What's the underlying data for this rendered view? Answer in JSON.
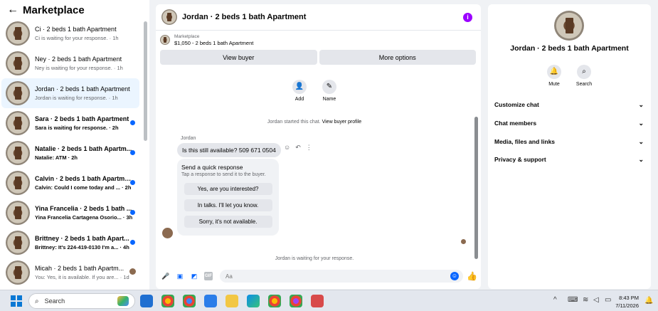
{
  "sidebar": {
    "title": "Marketplace",
    "chats": [
      {
        "name": "Ci · 2 beds 1 bath Apartment",
        "preview": "Ci is waiting for your response. · 1h",
        "unread": false,
        "active": false
      },
      {
        "name": "Ney · 2 beds 1 bath Apartment",
        "preview": "Ney is waiting for your response. · 1h",
        "unread": false,
        "active": false
      },
      {
        "name": "Jordan · 2 beds 1 bath Apartment",
        "preview": "Jordan is waiting for response. · 1h",
        "unread": false,
        "active": true
      },
      {
        "name": "Sara · 2 beds 1 bath Apartment",
        "preview": "Sara is waiting for response. · 2h",
        "unread": true,
        "active": false
      },
      {
        "name": "Natalie · 2 beds 1 bath Apartm...",
        "preview": "Natalie: ATM · 2h",
        "unread": true,
        "active": false
      },
      {
        "name": "Calvin · 2 beds 1 bath Apartment",
        "preview": "Calvin: Could I come today and ... · 2h",
        "unread": true,
        "active": false
      },
      {
        "name": "Yina Francelia · 2 beds 1 bath ...",
        "preview": "Yina Francelia Cartagena Osorio... · 3h",
        "unread": true,
        "active": false
      },
      {
        "name": "Brittney · 2 beds 1 bath Apart...",
        "preview": "Brittney: It's 224-419-0130 I'm a... · 4h",
        "unread": true,
        "active": false
      },
      {
        "name": "Micah · 2 beds 1 bath Apartm...",
        "preview": "You: Yes, it is available. If you are... · 1d",
        "unread": false,
        "active": false
      }
    ]
  },
  "conversation": {
    "title": "Jordan · 2 beds 1 bath Apartment",
    "listing_label": "Marketplace",
    "listing_price": "$1,050 - 2 beds 1 bath Apartment",
    "view_buyer": "View buyer",
    "more_options": "More options",
    "add_label": "Add",
    "name_label": "Name",
    "started_text": "Jordan started this chat.",
    "view_profile": "View buyer profile",
    "sender": "Jordan",
    "message": "Is this still available? 509 671 0504",
    "quick_title": "Send a quick response",
    "quick_sub": "Tap a response to send it to the buyer.",
    "quick_responses": [
      "Yes, are you interested?",
      "In talks. I'll let you know.",
      "Sorry, it's not available."
    ],
    "waiting_text": "Jordan is waiting for your response.",
    "input_placeholder": "Aa"
  },
  "details": {
    "title": "Jordan · 2 beds 1 bath Apartment",
    "mute": "Mute",
    "search": "Search",
    "menu": [
      "Customize chat",
      "Chat members",
      "Media, files and links",
      "Privacy & support"
    ]
  },
  "taskbar": {
    "search": "Search",
    "time": "8:43 PM",
    "date": "7/11/2026"
  },
  "colors": {
    "accent": "#0866ff",
    "info": "#9b00ff"
  }
}
